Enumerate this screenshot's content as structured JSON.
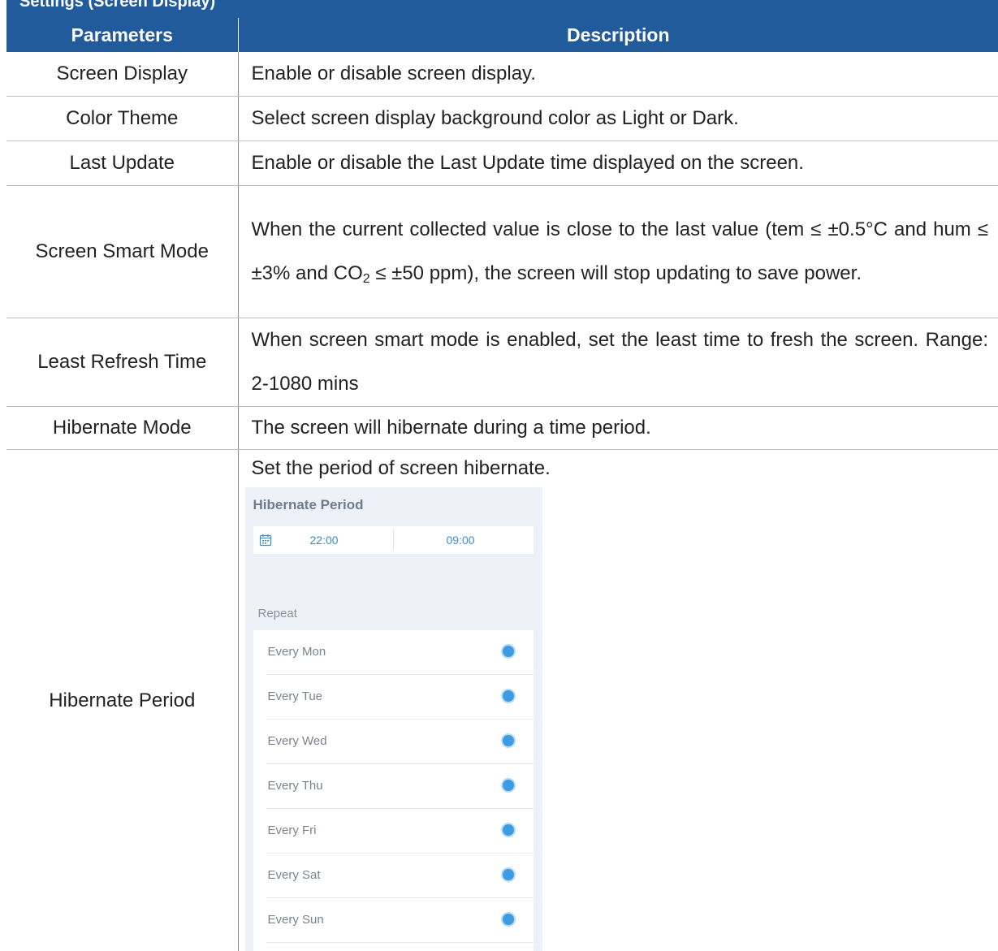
{
  "section": {
    "heading": "Settings (Screen Display)"
  },
  "table": {
    "headers": {
      "parameters": "Parameters",
      "description": "Description"
    },
    "rows": [
      {
        "parameter": "Screen Display",
        "description": "Enable or disable screen display."
      },
      {
        "parameter": "Color Theme",
        "description": "Select screen display background color as Light or Dark."
      },
      {
        "parameter": "Last Update",
        "description": "Enable or disable the Last Update time displayed on the screen."
      },
      {
        "parameter": "Screen Smart Mode",
        "description_a": "When the current collected value is close to the last value (tem ≤ ±0.5°C and hum ≤ ±3% and CO",
        "description_sub": "2",
        "description_b": " ≤ ±50 ppm), the screen will stop updating to save power."
      },
      {
        "parameter": "Least Refresh Time",
        "description": "When screen smart mode is enabled, set the least time to fresh the screen. Range: 2-1080 mins"
      },
      {
        "parameter": "Hibernate Mode",
        "description": "The screen will hibernate during a time period."
      },
      {
        "parameter": "Hibernate Period",
        "description": "Set the period of screen hibernate."
      }
    ]
  },
  "hibernate_ui": {
    "title": "Hibernate Period",
    "start_time": "22:00",
    "end_time": "09:00",
    "repeat_label": "Repeat",
    "days": [
      "Every Mon",
      "Every Tue",
      "Every Wed",
      "Every Thu",
      "Every Fri",
      "Every Sat",
      "Every Sun"
    ],
    "selected": [
      true,
      true,
      true,
      true,
      true,
      true,
      true
    ],
    "icons": {
      "calendar": "calendar-icon",
      "radio": "radio-selected-icon"
    },
    "colors": {
      "accent": "#3e9be2",
      "header": "#215b9c",
      "panel": "#eff1f8"
    }
  }
}
